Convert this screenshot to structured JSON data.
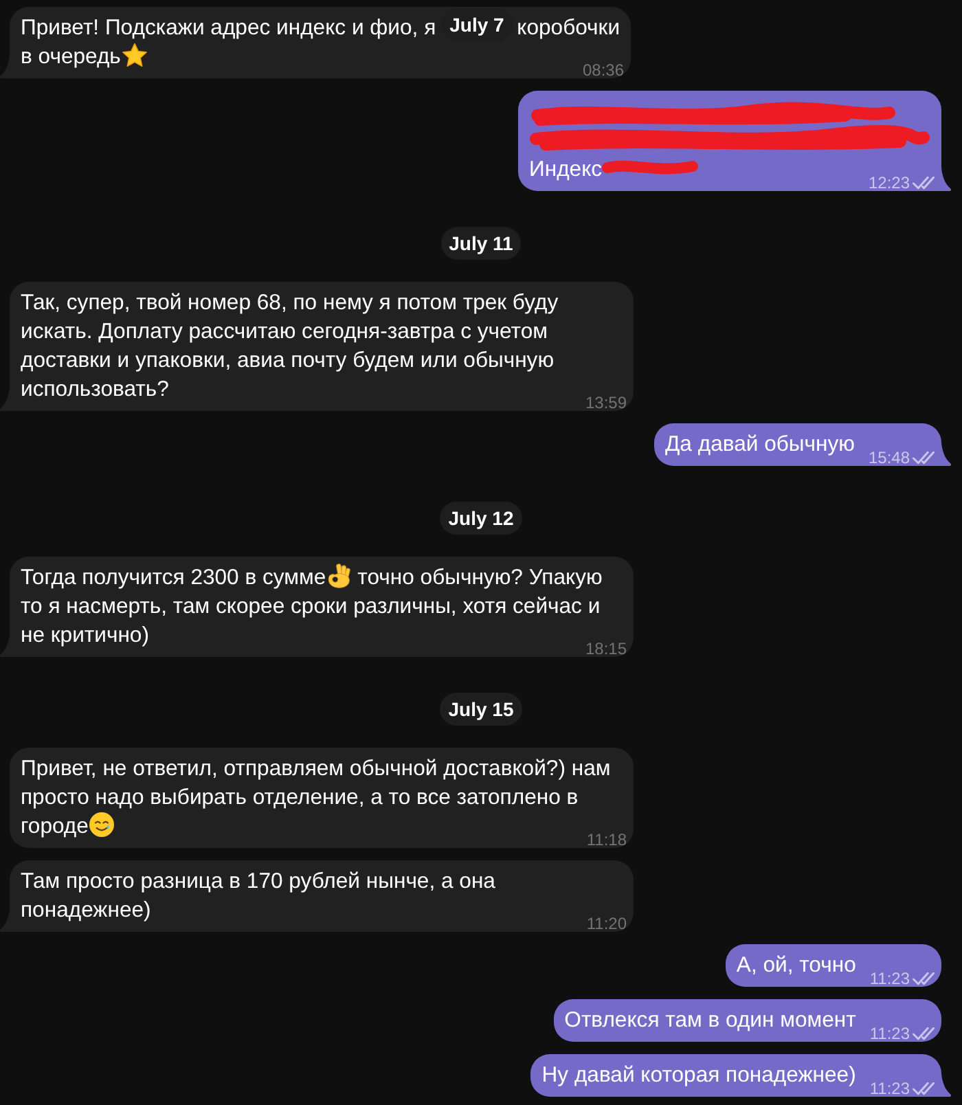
{
  "chat": {
    "items": [
      {
        "kind": "date",
        "label": "July 7",
        "sticky": true
      },
      {
        "kind": "incoming",
        "redacted": false,
        "parts": [
          {
            "kind": "text",
            "text": "Привет! Подскажи адрес индекс и фио, я"
          },
          {
            "kind": "covered"
          },
          {
            "kind": "text",
            "text": "коробочки"
          },
          {
            "kind": "break"
          },
          {
            "kind": "text",
            "text": "в очередь"
          },
          {
            "kind": "star"
          }
        ],
        "time": "08:36"
      },
      {
        "kind": "outgoing",
        "redacted": true,
        "parts": [
          {
            "kind": "text",
            "text": "Индекс"
          }
        ],
        "time": "12:23",
        "read": true
      },
      {
        "kind": "date",
        "label": "July 11",
        "sticky": false
      },
      {
        "kind": "incoming",
        "redacted": false,
        "parts": [
          {
            "kind": "text",
            "text": "Так, супер, твой номер 68, по нему я потом трек буду искать. Доплату рассчитаю сегодня-завтра с учетом доставки и упаковки, авиа почту будем или обычную использовать?"
          }
        ],
        "time": "13:59"
      },
      {
        "kind": "outgoing",
        "redacted": false,
        "parts": [
          {
            "kind": "text",
            "text": "Да давай обычную"
          }
        ],
        "time": "15:48",
        "read": true
      },
      {
        "kind": "date",
        "label": "July 12",
        "sticky": false
      },
      {
        "kind": "incoming",
        "redacted": false,
        "parts": [
          {
            "kind": "text",
            "text": "Тогда получится 2300 в сумме"
          },
          {
            "kind": "okhand"
          },
          {
            "kind": "text",
            "text": "точно обычную? Упакую то я насмерть, там скорее сроки различны, хотя сейчас и не критично)"
          }
        ],
        "time": "18:15"
      },
      {
        "kind": "date",
        "label": "July 15",
        "sticky": false
      },
      {
        "kind": "incoming",
        "redacted": false,
        "parts": [
          {
            "kind": "text",
            "text": "Привет, не ответил, отправляем обычной доставкой?) нам просто надо выбирать отделение, а то все затоплено в городе"
          },
          {
            "kind": "tearface"
          }
        ],
        "time": "11:18"
      },
      {
        "kind": "incoming",
        "redacted": false,
        "parts": [
          {
            "kind": "text",
            "text": "Там просто разница в 170 рублей нынче, а она понадежнее)"
          }
        ],
        "time": "11:20"
      },
      {
        "kind": "outgoing",
        "redacted": false,
        "parts": [
          {
            "kind": "text",
            "text": "А, ой, точно"
          }
        ],
        "time": "11:23",
        "read": true
      },
      {
        "kind": "outgoing",
        "redacted": false,
        "parts": [
          {
            "kind": "text",
            "text": "Отвлекся там в один момент"
          }
        ],
        "time": "11:23",
        "read": true
      },
      {
        "kind": "outgoing",
        "redacted": false,
        "parts": [
          {
            "kind": "text",
            "text": "Ну давай которая понадежнее)"
          }
        ],
        "time": "11:23",
        "read": true
      }
    ]
  }
}
